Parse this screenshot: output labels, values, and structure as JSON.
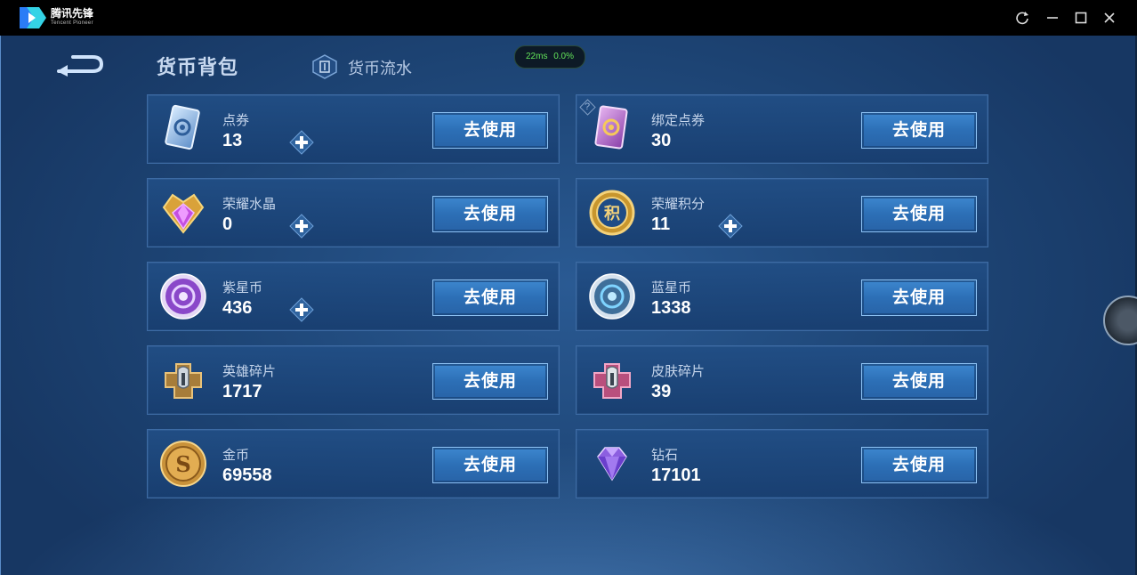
{
  "window": {
    "app_name": "腾讯先锋",
    "app_name_en": "Tencent Pioneer",
    "icons": [
      "refresh-icon",
      "minimize-icon",
      "maximize-icon",
      "close-icon"
    ]
  },
  "header": {
    "title": "货币背包",
    "flow_tab_label": "货币流水"
  },
  "network": {
    "latency": "22ms",
    "loss": "0.0%"
  },
  "use_label": "去使用",
  "colors": {
    "panel": "#1e4677",
    "button": "#2c6fb6",
    "ping_text": "#63e55a"
  },
  "currencies": [
    {
      "name": "点券",
      "amount": "13",
      "icon": "coupon-card-icon",
      "has_plus": true
    },
    {
      "name": "绑定点券",
      "amount": "30",
      "icon": "bound-coupon-card-icon",
      "has_plus": false,
      "has_help": true,
      "help": "?"
    },
    {
      "name": "荣耀水晶",
      "amount": "0",
      "icon": "glory-crystal-icon",
      "has_plus": true
    },
    {
      "name": "荣耀积分",
      "amount": "11",
      "icon": "glory-points-icon",
      "icon_text": "积",
      "has_plus": true
    },
    {
      "name": "紫星币",
      "amount": "436",
      "icon": "purple-star-coin-icon",
      "has_plus": true
    },
    {
      "name": "蓝星币",
      "amount": "1338",
      "icon": "blue-star-coin-icon",
      "has_plus": false
    },
    {
      "name": "英雄碎片",
      "amount": "1717",
      "icon": "hero-fragment-icon",
      "has_plus": false
    },
    {
      "name": "皮肤碎片",
      "amount": "39",
      "icon": "skin-fragment-icon",
      "has_plus": false
    },
    {
      "name": "金币",
      "amount": "69558",
      "icon": "gold-coin-icon",
      "icon_text": "S",
      "has_plus": false
    },
    {
      "name": "钻石",
      "amount": "17101",
      "icon": "diamond-icon",
      "has_plus": false
    }
  ]
}
